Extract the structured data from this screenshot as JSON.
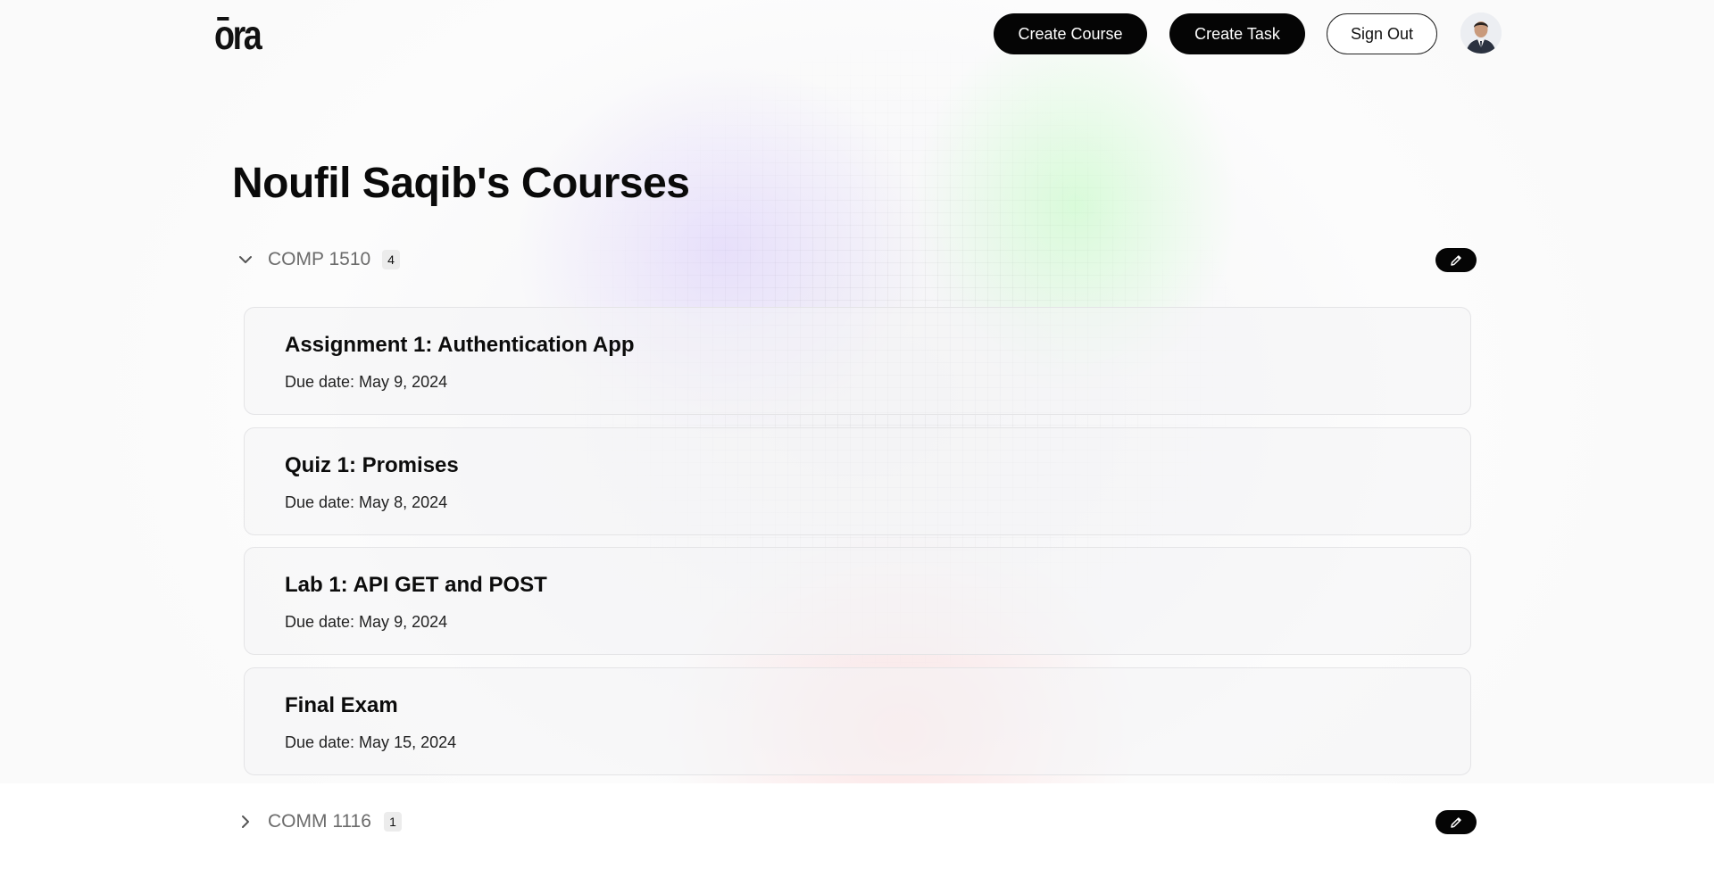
{
  "header": {
    "logo_text": "ora",
    "create_course_label": "Create Course",
    "create_task_label": "Create Task",
    "sign_out_label": "Sign Out"
  },
  "page_title": "Noufil Saqib's Courses",
  "courses": [
    {
      "code": "COMP 1510",
      "count": "4",
      "expanded": true,
      "tasks": [
        {
          "title": "Assignment 1: Authentication App",
          "due": "Due date: May 9, 2024"
        },
        {
          "title": "Quiz 1: Promises",
          "due": "Due date: May 8, 2024"
        },
        {
          "title": "Lab 1: API GET and POST",
          "due": "Due date: May 9, 2024"
        },
        {
          "title": "Final Exam",
          "due": "Due date: May 15, 2024"
        }
      ]
    },
    {
      "code": "COMM 1116",
      "count": "1",
      "expanded": false,
      "tasks": []
    }
  ],
  "icons": {
    "expanded": "chevron-down-icon",
    "collapsed": "chevron-right-icon",
    "edit": "pencil-icon"
  },
  "colors": {
    "button_dark": "#050505",
    "muted_text": "#6b6b6b"
  }
}
